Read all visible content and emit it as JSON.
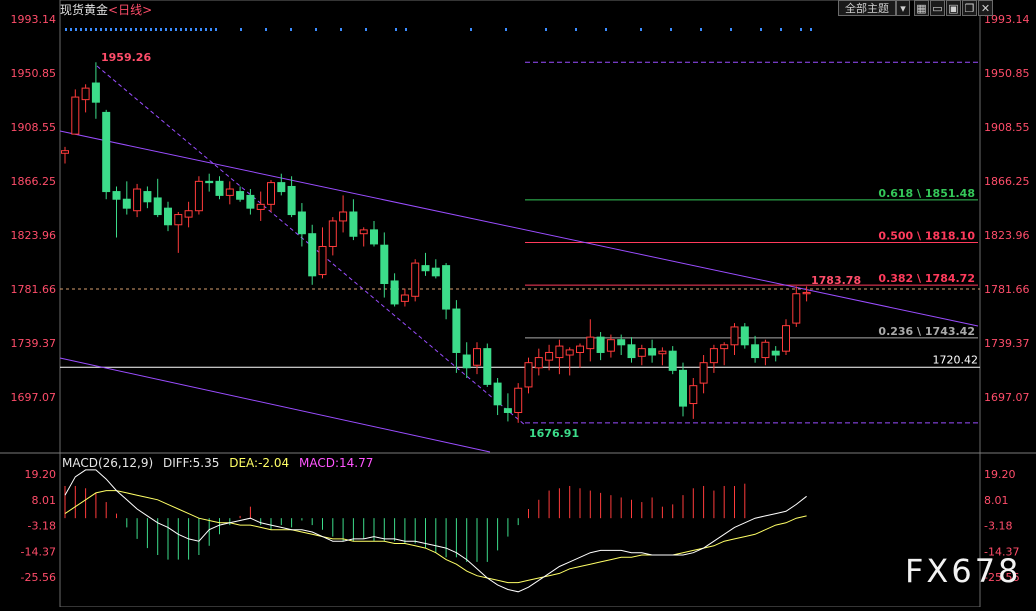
{
  "header": {
    "symbol": "现货黄金",
    "period_open": "<",
    "period": "日线",
    "period_close": ">",
    "theme_button": "全部主题",
    "toolbar_icons": [
      "dropdown-arrow-icon",
      "grid-icon",
      "zoom-out-icon",
      "zoom-in-icon",
      "window-icon",
      "close-icon"
    ]
  },
  "colors": {
    "up": "#ff3b3b",
    "down": "#3cdc8a",
    "price_label": "#ff4d6a",
    "trendline": "#9a4dff",
    "background": "#000000",
    "fib_0618": "#34c759",
    "fib_0500": "#ff3b5c",
    "fib_0382": "#ff3b5c",
    "fib_0236": "#aaaaaa",
    "diff_line": "#ffffff",
    "dea_line": "#ffff66",
    "macd_label": "#ff55ff"
  },
  "chart_data": [
    {
      "type": "candlestick",
      "title": "现货黄金<日线>",
      "y_ticks": [
        "1993.14",
        "1950.85",
        "1908.55",
        "1866.25",
        "1823.96",
        "1781.66",
        "1739.37",
        "1697.07"
      ],
      "ylim": [
        1655,
        2005
      ],
      "ohlc": [
        [
          1888,
          1893,
          1880,
          1890
        ],
        [
          1903,
          1938,
          1903,
          1932
        ],
        [
          1930,
          1942,
          1920,
          1939
        ],
        [
          1943,
          1959.26,
          1915,
          1928
        ],
        [
          1920,
          1922,
          1852,
          1858
        ],
        [
          1858,
          1862,
          1822,
          1852
        ],
        [
          1852,
          1866,
          1840,
          1845
        ],
        [
          1843,
          1864,
          1838,
          1860
        ],
        [
          1858,
          1862,
          1845,
          1850
        ],
        [
          1853,
          1868,
          1838,
          1840
        ],
        [
          1845,
          1850,
          1827,
          1832
        ],
        [
          1832,
          1842,
          1810,
          1840
        ],
        [
          1838,
          1850,
          1830,
          1843
        ],
        [
          1843,
          1870,
          1840,
          1866
        ],
        [
          1866,
          1872,
          1858,
          1865
        ],
        [
          1866,
          1870,
          1852,
          1855
        ],
        [
          1855,
          1866,
          1848,
          1860
        ],
        [
          1858,
          1862,
          1850,
          1852
        ],
        [
          1855,
          1860,
          1840,
          1845
        ],
        [
          1844,
          1858,
          1835,
          1848
        ],
        [
          1848,
          1867,
          1842,
          1865
        ],
        [
          1865,
          1872,
          1855,
          1858
        ],
        [
          1862,
          1870,
          1838,
          1840
        ],
        [
          1842,
          1849,
          1815,
          1825
        ],
        [
          1825,
          1832,
          1785,
          1792
        ],
        [
          1793,
          1830,
          1790,
          1815
        ],
        [
          1815,
          1838,
          1808,
          1835
        ],
        [
          1835,
          1855,
          1826,
          1842
        ],
        [
          1842,
          1852,
          1820,
          1823
        ],
        [
          1825,
          1830,
          1815,
          1828
        ],
        [
          1828,
          1835,
          1815,
          1817
        ],
        [
          1816,
          1826,
          1775,
          1786
        ],
        [
          1788,
          1794,
          1768,
          1770
        ],
        [
          1772,
          1782,
          1768,
          1777
        ],
        [
          1776,
          1805,
          1772,
          1802
        ],
        [
          1800,
          1810,
          1792,
          1796
        ],
        [
          1798,
          1805,
          1790,
          1792
        ],
        [
          1800,
          1802,
          1758,
          1766
        ],
        [
          1766,
          1773,
          1716,
          1732
        ],
        [
          1730,
          1740,
          1712,
          1720
        ],
        [
          1722,
          1740,
          1715,
          1735
        ],
        [
          1735,
          1739,
          1705,
          1707
        ],
        [
          1708,
          1712,
          1683,
          1691
        ],
        [
          1688,
          1700,
          1678,
          1685
        ],
        [
          1685,
          1708,
          1676.91,
          1704
        ],
        [
          1705,
          1728,
          1700,
          1724
        ],
        [
          1720,
          1735,
          1714,
          1728
        ],
        [
          1726,
          1738,
          1718,
          1732
        ],
        [
          1728,
          1742,
          1715,
          1737
        ],
        [
          1730,
          1736,
          1714,
          1734
        ],
        [
          1732,
          1739,
          1720,
          1737
        ],
        [
          1735,
          1758,
          1725,
          1744
        ],
        [
          1744,
          1748,
          1726,
          1732
        ],
        [
          1733,
          1746,
          1728,
          1742
        ],
        [
          1742,
          1746,
          1730,
          1738
        ],
        [
          1738,
          1744,
          1724,
          1728
        ],
        [
          1729,
          1738,
          1722,
          1735
        ],
        [
          1735,
          1742,
          1724,
          1730
        ],
        [
          1731,
          1736,
          1722,
          1733
        ],
        [
          1733,
          1737,
          1715,
          1718
        ],
        [
          1718,
          1724,
          1682,
          1690
        ],
        [
          1692,
          1712,
          1680,
          1706
        ],
        [
          1708,
          1730,
          1700,
          1724
        ],
        [
          1724,
          1738,
          1716,
          1735
        ],
        [
          1735,
          1740,
          1722,
          1738
        ],
        [
          1738,
          1755,
          1730,
          1752
        ],
        [
          1752,
          1755,
          1735,
          1738
        ],
        [
          1738,
          1745,
          1724,
          1728
        ],
        [
          1728,
          1742,
          1722,
          1740
        ],
        [
          1733,
          1737,
          1725,
          1730
        ],
        [
          1733,
          1758,
          1730,
          1753
        ],
        [
          1755,
          1783.78,
          1752,
          1778
        ],
        [
          1778,
          1783.78,
          1772,
          1779
        ]
      ],
      "annotations": {
        "high": "1959.26",
        "low": "1676.91",
        "last_high": "1783.78"
      },
      "fib_levels": [
        {
          "label": "0.618 \\ 1851.48",
          "value": 1851.48
        },
        {
          "label": "0.500 \\ 1818.10",
          "value": 1818.1
        },
        {
          "label": "0.382 \\ 1784.72",
          "value": 1784.72
        },
        {
          "label": "0.236 \\ 1743.42",
          "value": 1743.42
        }
      ],
      "horizontal_line": {
        "label": "1720.42",
        "value": 1720.42
      },
      "current_price_line": 1781.66
    },
    {
      "type": "macd",
      "label": "MACD(26,12,9)",
      "diff_label": "DIFF:5.35",
      "dea_label": "DEA:-2.04",
      "macd_label": "MACD:14.77",
      "y_ticks": [
        "19.20",
        "8.01",
        "-3.18",
        "-14.37",
        "-25.56"
      ],
      "ylim": [
        -33,
        25
      ],
      "diff": [
        10,
        18,
        21,
        21,
        17,
        12,
        8,
        4,
        1,
        -2,
        -4,
        -7,
        -9,
        -10,
        -5,
        -3,
        -2,
        -1,
        0,
        -2,
        -3,
        -4,
        -5,
        -5,
        -6,
        -8,
        -10,
        -10,
        -9,
        -9,
        -8,
        -9,
        -9,
        -10,
        -10,
        -11,
        -12,
        -13,
        -15,
        -18,
        -22,
        -26,
        -29,
        -31,
        -32,
        -30,
        -27,
        -24,
        -21,
        -19,
        -17,
        -15,
        -14,
        -14,
        -14,
        -15,
        -15,
        -16,
        -16,
        -16,
        -16,
        -15,
        -13,
        -10,
        -7,
        -4,
        -2,
        0,
        1,
        2,
        3,
        6,
        9.5
      ],
      "dea": [
        2,
        5,
        8,
        11,
        12,
        12,
        11,
        10,
        9,
        8,
        6,
        4,
        2,
        0,
        -1,
        -2,
        -2,
        -3,
        -3,
        -4,
        -5,
        -5,
        -5,
        -6,
        -7,
        -8,
        -9,
        -9,
        -10,
        -10,
        -10,
        -10,
        -11,
        -11,
        -12,
        -13,
        -15,
        -18,
        -20,
        -23,
        -25,
        -26,
        -27,
        -28,
        -28,
        -27,
        -26,
        -25,
        -24,
        -22,
        -21,
        -20,
        -19,
        -18,
        -17,
        -17,
        -16,
        -16,
        -16,
        -16,
        -15,
        -14,
        -13,
        -12,
        -10,
        -9,
        -8,
        -7,
        -5,
        -3,
        -2,
        0,
        1
      ],
      "macd": [
        14,
        14,
        13,
        11,
        7,
        2,
        -4,
        -9,
        -13,
        -16,
        -18,
        -18,
        -18,
        -16,
        -12,
        -7,
        -3,
        1,
        5,
        -3,
        -5,
        -3,
        -4,
        -1,
        -3,
        -5,
        -8,
        -10,
        -10,
        -9,
        -10,
        -10,
        -10,
        -11,
        -11,
        -13,
        -15,
        -17,
        -17,
        -19,
        -19,
        -19,
        -14,
        -8,
        -3,
        4,
        8,
        12,
        13,
        14,
        13,
        12,
        11,
        10,
        9,
        8,
        7,
        9,
        5,
        6,
        10,
        13,
        14,
        12,
        14,
        14,
        15
      ]
    }
  ],
  "watermark": "FX678"
}
